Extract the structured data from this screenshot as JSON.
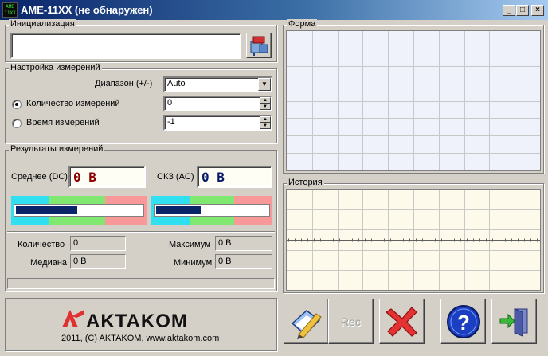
{
  "window": {
    "title": "AME-11XX (не обнаружен)",
    "icon_text": "AME 11XX",
    "controls": [
      "_",
      "□",
      "×"
    ]
  },
  "init": {
    "title": "Инициализация",
    "value": ""
  },
  "settings": {
    "title": "Настройка измерений",
    "range_label": "Диапазон (+/-)",
    "range_value": "Auto",
    "count_label": "Количество измерений",
    "count_value": "0",
    "count_selected": true,
    "time_label": "Время измерений",
    "time_value": "-1"
  },
  "results": {
    "title": "Результаты измерений",
    "dc_label": "Среднее (DC)",
    "dc_value": "0  В",
    "ac_label": "СКЗ (AC)",
    "ac_value": "0  В",
    "dc_meter_level": 0.5,
    "ac_meter_level": 0.42,
    "count_label": "Количество",
    "count_value": "0",
    "median_label": "Медиана",
    "median_value": "0 В",
    "max_label": "Максимум",
    "max_value": "0 В",
    "min_label": "Минимум",
    "min_value": "0 В"
  },
  "form_panel": {
    "title": "Форма"
  },
  "history_panel": {
    "title": "История"
  },
  "logo": {
    "brand": "AKTAKOM",
    "caption": "2011, (C) AKTAKOM, www.aktakom.com"
  },
  "toolbar": {
    "rec_label": "Rec"
  },
  "colors": {
    "grid_form_bg": "#f0f2fb",
    "grid_history_bg": "#fdfaeb",
    "meter_cyan": "#30e0f0",
    "meter_green": "#80e870",
    "meter_red": "#f89898",
    "meter_fill": "#0a246a",
    "logo_red": "#e03030"
  }
}
